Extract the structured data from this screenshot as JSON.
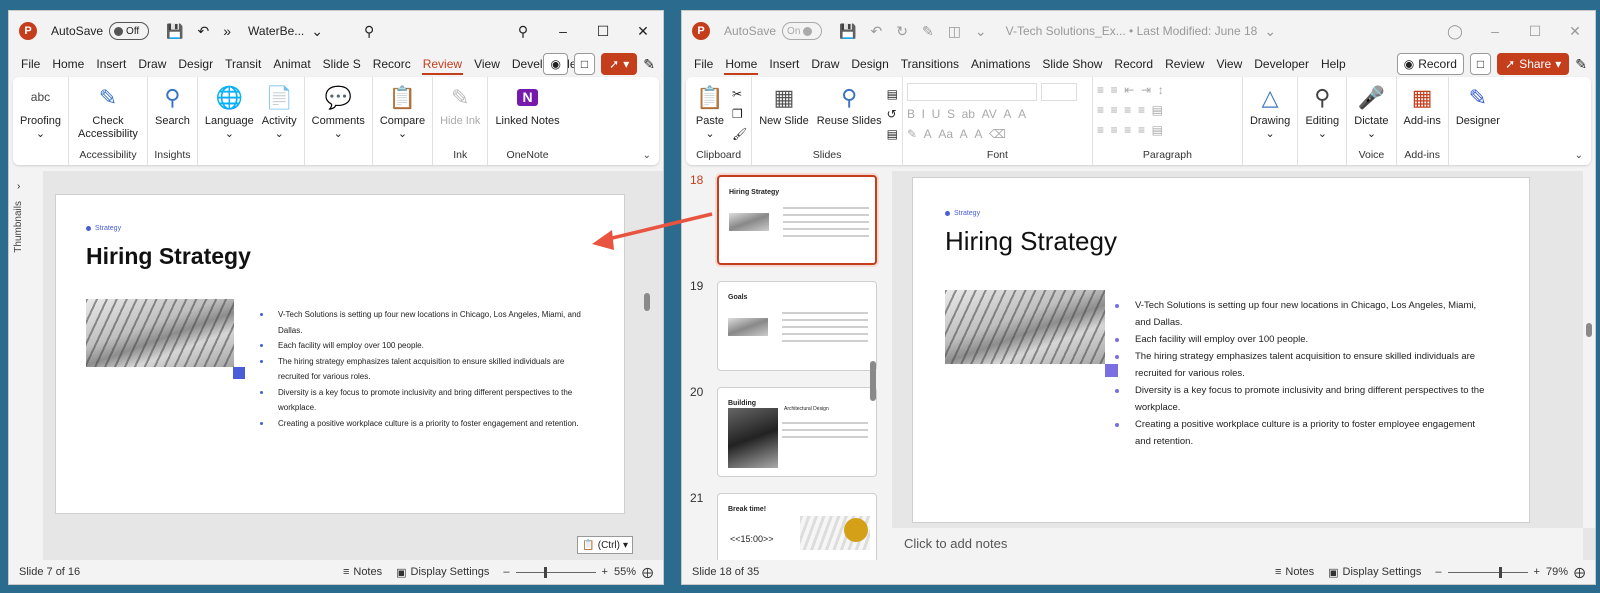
{
  "left": {
    "autosave_label": "AutoSave",
    "autosave_state": "Off",
    "filename": "WaterBe...",
    "tabs": [
      "File",
      "Home",
      "Insert",
      "Draw",
      "Desigr",
      "Transit",
      "Animat",
      "Slide S",
      "Recorc",
      "Review",
      "View",
      "Develo",
      "Help"
    ],
    "active_tab": "Review",
    "groups": {
      "proofing": "Proofing",
      "accessibility_btn": "Check Accessibility",
      "accessibility": "Accessibility",
      "search": "Search",
      "insights": "Insights",
      "language": "Language",
      "activity": "Activity",
      "comments": "Comments",
      "compare": "Compare",
      "hide_ink": "Hide Ink",
      "ink": "Ink",
      "linked_notes": "Linked Notes",
      "onenote": "OneNote",
      "proof_abc": "abc"
    },
    "thumbnails_label": "Thumbnails",
    "slide": {
      "kicker": "Strategy",
      "title": "Hiring Strategy",
      "bullets": [
        "V-Tech Solutions is setting up four new locations in Chicago, Los Angeles, Miami, and Dallas.",
        "Each facility will employ over 100 people.",
        "The hiring strategy emphasizes talent acquisition to ensure skilled individuals are recruited for various roles.",
        "Diversity is a key focus to promote inclusivity and bring different perspectives to the workplace.",
        "Creating a positive workplace culture is a priority to foster engagement and retention."
      ]
    },
    "paste_chip": "(Ctrl)",
    "status": {
      "slide_info": "Slide 7 of 16",
      "notes": "Notes",
      "display": "Display Settings",
      "zoom": "55%",
      "zoom_fraction": 0.36
    }
  },
  "right": {
    "autosave_label": "AutoSave",
    "autosave_state": "On",
    "title": "V-Tech Solutions_Ex... • Last Modified: June 18",
    "tabs": [
      "File",
      "Home",
      "Insert",
      "Draw",
      "Design",
      "Transitions",
      "Animations",
      "Slide Show",
      "Record",
      "Review",
      "View",
      "Developer",
      "Help"
    ],
    "active_tab": "Home",
    "record_btn": "Record",
    "share_btn": "Share",
    "groups": {
      "paste": "Paste",
      "clipboard": "Clipboard",
      "new_slide": "New Slide",
      "reuse_slides": "Reuse Slides",
      "slides": "Slides",
      "font": "Font",
      "paragraph": "Paragraph",
      "drawing": "Drawing",
      "editing": "Editing",
      "dictate": "Dictate",
      "voice": "Voice",
      "addins_btn": "Add-ins",
      "addins": "Add-ins",
      "designer": "Designer"
    },
    "thumbs": [
      {
        "num": "18",
        "title": "Hiring Strategy"
      },
      {
        "num": "19",
        "title": "Goals"
      },
      {
        "num": "20",
        "title": "Building",
        "subtitle": "Architectural Design"
      },
      {
        "num": "21",
        "title": "Break time!",
        "text": "<<15:00>>"
      }
    ],
    "slide": {
      "kicker": "Strategy",
      "title": "Hiring Strategy",
      "bullets": [
        "V-Tech Solutions is setting up four new locations in Chicago, Los Angeles, Miami, and Dallas.",
        "Each facility will employ over 100 people.",
        "The hiring strategy emphasizes talent acquisition to ensure skilled individuals are recruited for various roles.",
        "Diversity is a key focus to promote inclusivity and bring different perspectives to the workplace.",
        "Creating a positive workplace culture is a priority to foster employee engagement and retention."
      ]
    },
    "notes_placeholder": "Click to add notes",
    "status": {
      "slide_info": "Slide 18 of 35",
      "notes": "Notes",
      "display": "Display Settings",
      "zoom": "79%",
      "zoom_fraction": 0.64
    }
  },
  "colors": {
    "accent": "#c43e1c",
    "bullet": "#4a5dd8",
    "arrow": "#e8543f"
  }
}
